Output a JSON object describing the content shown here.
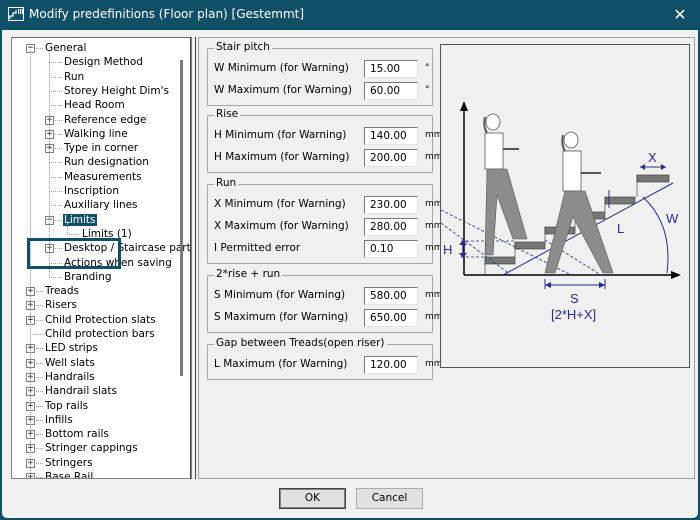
{
  "window": {
    "title": "Modify predefinitions (Floor plan) [Gestemmt]",
    "icon": "app-icon",
    "close_icon": "close-icon",
    "close_glyph": "✕"
  },
  "tree": {
    "expand_glyph": "+",
    "collapse_glyph": "−",
    "items": [
      {
        "label": "General",
        "level": 0,
        "expander": "collapse"
      },
      {
        "label": "Design Method",
        "level": 1,
        "expander": "none"
      },
      {
        "label": "Run",
        "level": 1,
        "expander": "none"
      },
      {
        "label": "Storey Height Dim's",
        "level": 1,
        "expander": "none"
      },
      {
        "label": "Head Room",
        "level": 1,
        "expander": "none"
      },
      {
        "label": "Reference edge",
        "level": 1,
        "expander": "expand"
      },
      {
        "label": "Walking line",
        "level": 1,
        "expander": "expand"
      },
      {
        "label": "Type in corner",
        "level": 1,
        "expander": "expand"
      },
      {
        "label": "Run designation",
        "level": 1,
        "expander": "none"
      },
      {
        "label": "Measurements",
        "level": 1,
        "expander": "none"
      },
      {
        "label": "Inscription",
        "level": 1,
        "expander": "none"
      },
      {
        "label": "Auxiliary lines",
        "level": 1,
        "expander": "none"
      },
      {
        "label": "Limits",
        "level": 1,
        "expander": "collapse",
        "selected": true
      },
      {
        "label": "Limits (1)",
        "level": 2,
        "expander": "none"
      },
      {
        "label": "Desktop / Staircase parts",
        "level": 1,
        "expander": "expand"
      },
      {
        "label": "Actions when saving",
        "level": 1,
        "expander": "none"
      },
      {
        "label": "Branding",
        "level": 1,
        "expander": "none"
      },
      {
        "label": "Treads",
        "level": 0,
        "expander": "expand"
      },
      {
        "label": "Risers",
        "level": 0,
        "expander": "expand"
      },
      {
        "label": "Child Protection slats",
        "level": 0,
        "expander": "expand"
      },
      {
        "label": "Child protection bars",
        "level": 0,
        "expander": "none"
      },
      {
        "label": "LED strips",
        "level": 0,
        "expander": "expand"
      },
      {
        "label": "Well slats",
        "level": 0,
        "expander": "expand"
      },
      {
        "label": "Handrails",
        "level": 0,
        "expander": "expand"
      },
      {
        "label": "Handrail slats",
        "level": 0,
        "expander": "expand"
      },
      {
        "label": "Top rails",
        "level": 0,
        "expander": "expand"
      },
      {
        "label": "Infills",
        "level": 0,
        "expander": "expand"
      },
      {
        "label": "Bottom rails",
        "level": 0,
        "expander": "expand"
      },
      {
        "label": "Stringer cappings",
        "level": 0,
        "expander": "expand"
      },
      {
        "label": "Stringers",
        "level": 0,
        "expander": "expand"
      },
      {
        "label": "Base Rail",
        "level": 0,
        "expander": "expand"
      }
    ]
  },
  "groups": [
    {
      "title": "Stair pitch",
      "fields": [
        {
          "label": "W Minimum (for Warning)",
          "value": "15.00",
          "unit": "°"
        },
        {
          "label": "W Maximum (for Warning)",
          "value": "60.00",
          "unit": "°"
        }
      ]
    },
    {
      "title": "Rise",
      "fields": [
        {
          "label": "H Minimum (for Warning)",
          "value": "140.00",
          "unit": "mm"
        },
        {
          "label": "H Maximum (for Warning)",
          "value": "200.00",
          "unit": "mm"
        }
      ]
    },
    {
      "title": "Run",
      "fields": [
        {
          "label": "X Minimum (for Warning)",
          "value": "230.00",
          "unit": "mm"
        },
        {
          "label": "X Maximum (for Warning)",
          "value": "280.00",
          "unit": "mm"
        },
        {
          "label": "I Permitted error",
          "value": "0.10",
          "unit": "mm"
        }
      ]
    },
    {
      "title": "2*rise + run",
      "fields": [
        {
          "label": "S Minimum (for Warning)",
          "value": "580.00",
          "unit": "mm"
        },
        {
          "label": "S Maximum (for Warning)",
          "value": "650.00",
          "unit": "mm"
        }
      ]
    },
    {
      "title": "Gap between Treads(open riser)",
      "fields": [
        {
          "label": "L Maximum (for Warning)",
          "value": "120.00",
          "unit": "mm"
        }
      ]
    }
  ],
  "diagram": {
    "labels": {
      "x": "X",
      "w": "W",
      "l": "L",
      "h": "H",
      "s": "S",
      "formula": "[2*H+X]"
    },
    "colors": {
      "dimension": "#2a2a8a",
      "tread": "#777777",
      "figure": "#8c8c8c",
      "axis": "#000000"
    }
  },
  "buttons": {
    "ok": "OK",
    "cancel": "Cancel"
  },
  "colors": {
    "titlebar": "#0f5068",
    "selection": "#0f5068",
    "client_bg": "#f0f0f0"
  }
}
